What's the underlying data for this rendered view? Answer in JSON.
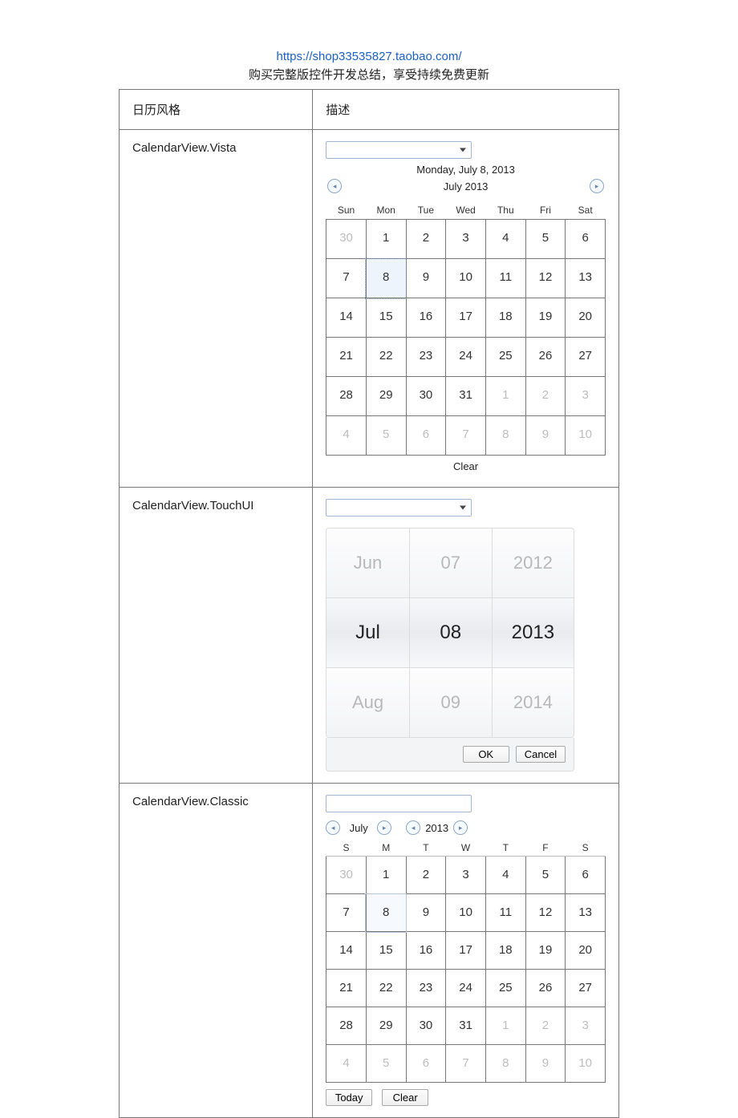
{
  "header": {
    "link_text": "https://shop33535827.taobao.com/",
    "subtitle": "购买完整版控件开发总结，享受持续免费更新"
  },
  "table": {
    "col1_header": "日历风格",
    "col2_header": "描述",
    "row1_style": "CalendarView.Vista",
    "row2_style": "CalendarView.TouchUI",
    "row3_style": "CalendarView.Classic"
  },
  "vista": {
    "date_title": "Monday, July 8, 2013",
    "month_label": "July 2013",
    "dow": [
      "Sun",
      "Mon",
      "Tue",
      "Wed",
      "Thu",
      "Fri",
      "Sat"
    ],
    "weeks": [
      [
        {
          "d": "30",
          "other": true
        },
        {
          "d": "1"
        },
        {
          "d": "2"
        },
        {
          "d": "3"
        },
        {
          "d": "4"
        },
        {
          "d": "5"
        },
        {
          "d": "6"
        }
      ],
      [
        {
          "d": "7"
        },
        {
          "d": "8",
          "sel": true
        },
        {
          "d": "9"
        },
        {
          "d": "10"
        },
        {
          "d": "11"
        },
        {
          "d": "12"
        },
        {
          "d": "13"
        }
      ],
      [
        {
          "d": "14"
        },
        {
          "d": "15"
        },
        {
          "d": "16"
        },
        {
          "d": "17"
        },
        {
          "d": "18"
        },
        {
          "d": "19"
        },
        {
          "d": "20"
        }
      ],
      [
        {
          "d": "21"
        },
        {
          "d": "22"
        },
        {
          "d": "23"
        },
        {
          "d": "24"
        },
        {
          "d": "25"
        },
        {
          "d": "26"
        },
        {
          "d": "27"
        }
      ],
      [
        {
          "d": "28"
        },
        {
          "d": "29"
        },
        {
          "d": "30"
        },
        {
          "d": "31"
        },
        {
          "d": "1",
          "other": true
        },
        {
          "d": "2",
          "other": true
        },
        {
          "d": "3",
          "other": true
        }
      ],
      [
        {
          "d": "4",
          "other": true
        },
        {
          "d": "5",
          "other": true
        },
        {
          "d": "6",
          "other": true
        },
        {
          "d": "7",
          "other": true
        },
        {
          "d": "8",
          "other": true
        },
        {
          "d": "9",
          "other": true
        },
        {
          "d": "10",
          "other": true
        }
      ]
    ],
    "clear_label": "Clear"
  },
  "touch": {
    "months": {
      "prev": "Jun",
      "curr": "Jul",
      "next": "Aug"
    },
    "days": {
      "prev": "07",
      "curr": "08",
      "next": "09"
    },
    "years": {
      "prev": "2012",
      "curr": "2013",
      "next": "2014"
    },
    "ok_label": "OK",
    "cancel_label": "Cancel"
  },
  "classic": {
    "month_label": "July",
    "year_label": "2013",
    "dow": [
      "S",
      "M",
      "T",
      "W",
      "T",
      "F",
      "S"
    ],
    "weeks": [
      [
        {
          "d": "30",
          "other": true
        },
        {
          "d": "1"
        },
        {
          "d": "2"
        },
        {
          "d": "3"
        },
        {
          "d": "4"
        },
        {
          "d": "5"
        },
        {
          "d": "6"
        }
      ],
      [
        {
          "d": "7"
        },
        {
          "d": "8",
          "sel": true
        },
        {
          "d": "9"
        },
        {
          "d": "10"
        },
        {
          "d": "11"
        },
        {
          "d": "12"
        },
        {
          "d": "13"
        }
      ],
      [
        {
          "d": "14"
        },
        {
          "d": "15"
        },
        {
          "d": "16"
        },
        {
          "d": "17"
        },
        {
          "d": "18"
        },
        {
          "d": "19"
        },
        {
          "d": "20"
        }
      ],
      [
        {
          "d": "21"
        },
        {
          "d": "22"
        },
        {
          "d": "23"
        },
        {
          "d": "24"
        },
        {
          "d": "25"
        },
        {
          "d": "26"
        },
        {
          "d": "27"
        }
      ],
      [
        {
          "d": "28"
        },
        {
          "d": "29"
        },
        {
          "d": "30"
        },
        {
          "d": "31"
        },
        {
          "d": "1",
          "other": true
        },
        {
          "d": "2",
          "other": true
        },
        {
          "d": "3",
          "other": true
        }
      ],
      [
        {
          "d": "4",
          "other": true
        },
        {
          "d": "5",
          "other": true
        },
        {
          "d": "6",
          "other": true
        },
        {
          "d": "7",
          "other": true
        },
        {
          "d": "8",
          "other": true
        },
        {
          "d": "9",
          "other": true
        },
        {
          "d": "10",
          "other": true
        }
      ]
    ],
    "today_label": "Today",
    "clear_label": "Clear"
  }
}
